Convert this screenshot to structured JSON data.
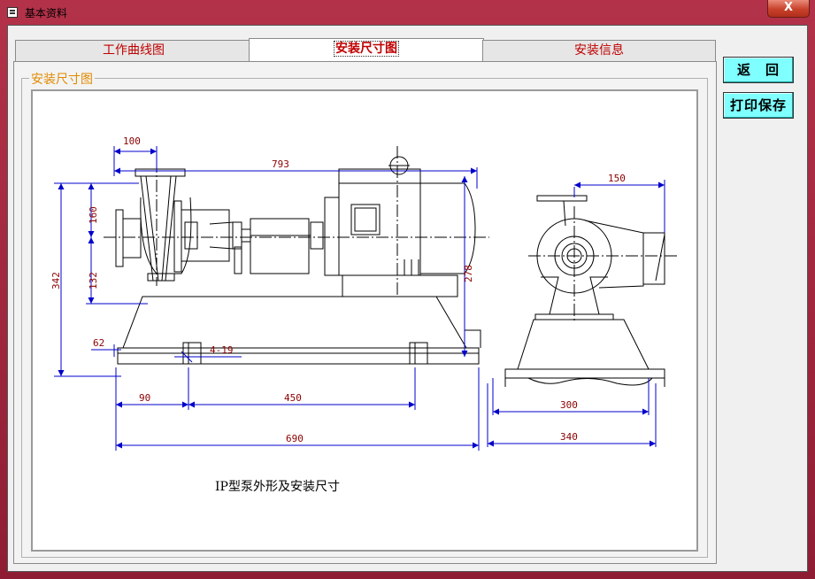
{
  "window": {
    "title": "基本资料",
    "close_label": "X"
  },
  "tabs": [
    {
      "label": "工作曲线图"
    },
    {
      "label": "安装尺寸图"
    },
    {
      "label": "安装信息"
    }
  ],
  "group": {
    "label": "安装尺寸图"
  },
  "drawing": {
    "caption": "IP型泵外形及安装尺寸",
    "dimensions": {
      "d100": "100",
      "d793": "793",
      "d150": "150",
      "d160": "160",
      "d132": "132",
      "d342": "342",
      "d278": "278",
      "d62": "62",
      "d4_19": "4-19",
      "d90": "90",
      "d450": "450",
      "d690": "690",
      "d300": "300",
      "d340": "340"
    }
  },
  "buttons": {
    "back": "返　回",
    "print_save": "打印保存"
  }
}
